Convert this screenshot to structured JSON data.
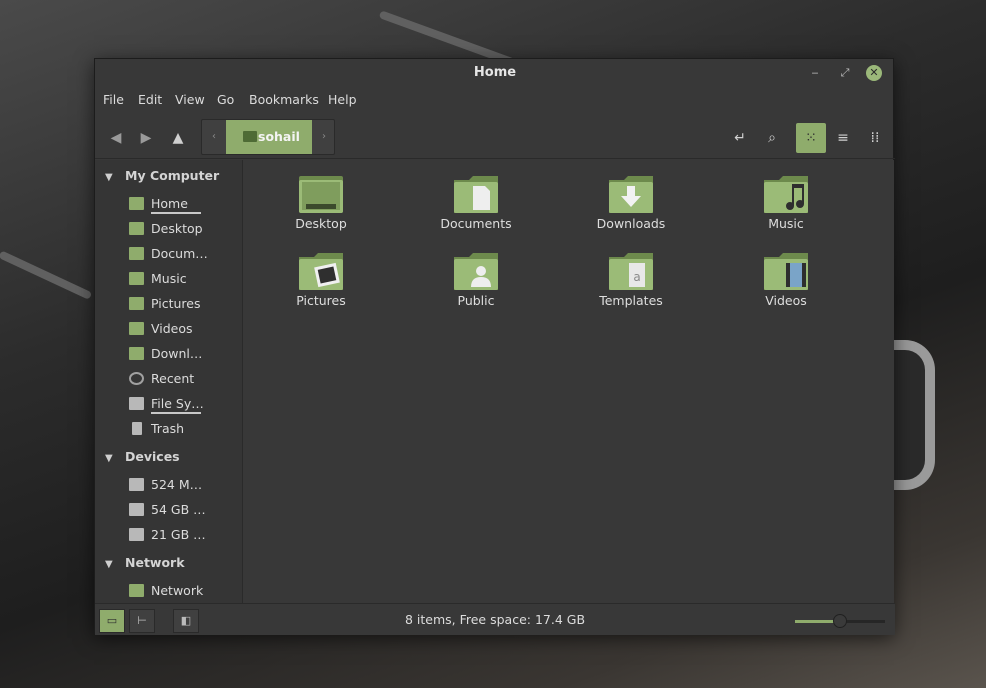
{
  "window": {
    "title": "Home"
  },
  "menu": [
    "File",
    "Edit",
    "View",
    "Go",
    "Bookmarks",
    "Help"
  ],
  "toolbar": {
    "back_icon": "arrow-left-icon",
    "forward_icon": "arrow-right-icon",
    "up_icon": "arrow-up-icon",
    "path_crumb": "sohail",
    "location_icon": "location-toggle-icon",
    "search_icon": "search-icon",
    "view_modes": [
      "icon-view",
      "list-view",
      "compact-view"
    ],
    "active_view": "icon-view"
  },
  "sidebar": {
    "sections": [
      {
        "title": "My Computer",
        "items": [
          "Home",
          "Desktop",
          "Docum…",
          "Music",
          "Pictures",
          "Videos",
          "Downl…",
          "Recent",
          "File Sy…",
          "Trash"
        ]
      },
      {
        "title": "Devices",
        "items": [
          "524 M…",
          "54 GB …",
          "21 GB …"
        ]
      },
      {
        "title": "Network",
        "items": [
          "Network"
        ]
      }
    ]
  },
  "folders": [
    "Desktop",
    "Documents",
    "Downloads",
    "Music",
    "Pictures",
    "Public",
    "Templates",
    "Videos"
  ],
  "status": {
    "text": "8 items, Free space: 17.4 GB",
    "zoom_fraction": 0.5
  },
  "colors": {
    "accent": "#8fac6c",
    "window_bg": "#383838",
    "sidebar_bg": "#353535"
  }
}
